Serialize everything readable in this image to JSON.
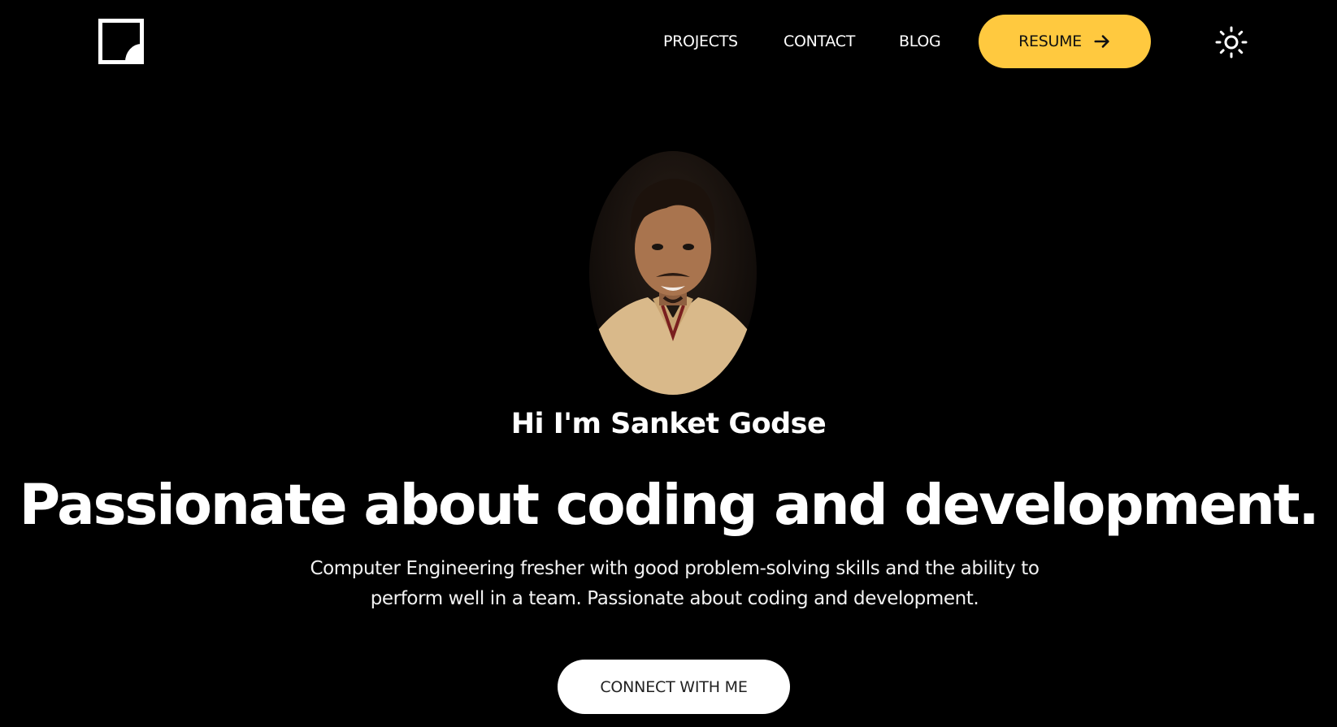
{
  "header": {
    "logo_icon": "brand-logo-icon",
    "nav": {
      "projects": "PROJECTS",
      "contact": "CONTACT",
      "blog": "BLOG"
    },
    "resume_label": "RESUME",
    "resume_icon": "arrow-right-icon",
    "theme_icon": "sun-icon"
  },
  "hero": {
    "greeting": "Hi I'm Sanket Godse",
    "headline": "Passionate about coding and development.",
    "bio": "Computer Engineering fresher with good problem-solving skills and the ability to perform well in a team. Passionate about coding and development.",
    "connect_label": "CONNECT WITH ME"
  },
  "colors": {
    "background": "#000000",
    "accent": "#FFC93F",
    "text": "#FFFFFF",
    "button_light": "#FFFFFF"
  }
}
